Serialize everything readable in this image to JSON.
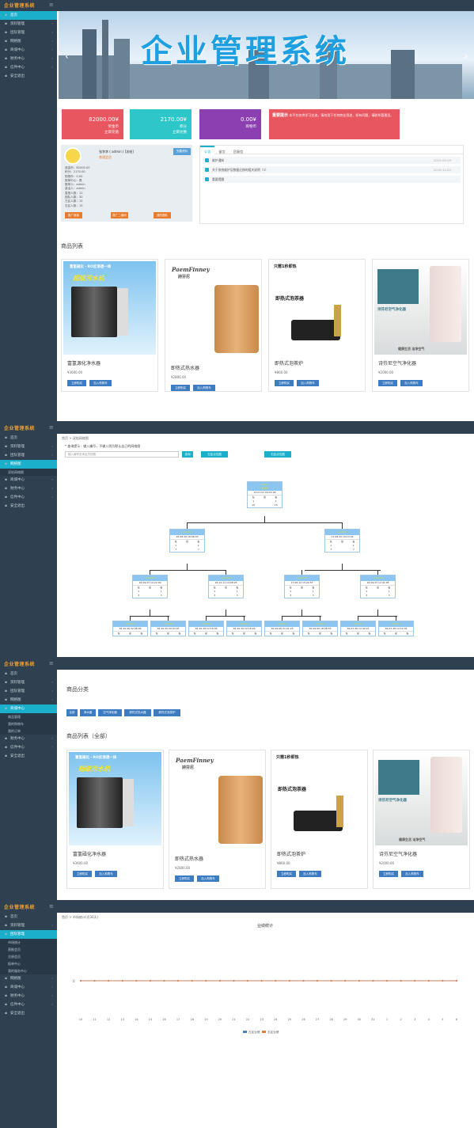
{
  "app": {
    "brand": "企业管理系统",
    "toggle_icon": "menu-icon"
  },
  "panel1": {
    "sidebar": [
      {
        "label": "首页",
        "active": true
      },
      {
        "label": "资料管理",
        "chevron": true
      },
      {
        "label": "团队管理",
        "chevron": true
      },
      {
        "label": "网络图",
        "chevron": true
      },
      {
        "label": "商城中心",
        "chevron": true
      },
      {
        "label": "财务中心",
        "chevron": true
      },
      {
        "label": "信件中心",
        "chevron": true
      },
      {
        "label": "安全退出",
        "chevron": false
      }
    ],
    "banner_title": "企业管理系统",
    "stats": [
      {
        "value": "82000.00¥",
        "label1": "奖金币",
        "label2": "立即充值",
        "color": "#e8575f"
      },
      {
        "value": "2170.00¥",
        "label1": "积分",
        "label2": "立即兑换",
        "color": "#2ec7c9"
      },
      {
        "value": "0.00¥",
        "label1": "购物币",
        "label2": "",
        "color": "#8b3fb0"
      }
    ],
    "notice": {
      "title": "重要提示",
      "text": "本平台仅供学习交流，请勿用于任何商业用途，如有问题，请联系管理员。"
    },
    "profile": {
      "name": "张李李 ( admin ) [冻结]",
      "level": "普通会员",
      "edit": "完善资料",
      "rows": [
        "奖金币：82000.00",
        "积分：2170.00",
        "购物币：0.00",
        "报单中心：是",
        "推荐人：admin",
        "激活人：admin",
        "直推人数：12",
        "团队人数：30",
        "左区人数：15",
        "右区人数：15"
      ],
      "buttons": [
        "推广链接",
        "推广二维码",
        "我的团队"
      ]
    },
    "tabs": [
      "公告",
      "留言",
      "回复信"
    ],
    "announcements": [
      {
        "text": "维护通知",
        "date": "2019-09-09"
      },
      {
        "text": "关于系统维护及数据迁移的相关说明（3）",
        "date": "2019-12-03"
      },
      {
        "text": "重要提醒",
        "date": ""
      }
    ],
    "products_title": "商品列表",
    "products": [
      {
        "name": "富氢源化净水器",
        "price": "¥3600.00",
        "buy": "立即购买",
        "cart": "加入购物车"
      },
      {
        "name": "即热式热水器",
        "price": "¥2800.00",
        "buy": "立即购买",
        "cart": "加入购物车"
      },
      {
        "name": "即热式泡茶炉",
        "price": "¥860.00",
        "buy": "立即购买",
        "cart": "加入购物车"
      },
      {
        "name": "诗芬尼空气净化器",
        "price": "¥2000.00",
        "buy": "立即购买",
        "cart": "加入购物车"
      }
    ],
    "img_texts": {
      "p1a": "富氢磁化・RO反渗透一体",
      "p1b": "超级污水机",
      "p2a": "PaemFinney",
      "p2b": "詩芬尼",
      "p3a": "只需1秒即热",
      "p3b": "即热式泡茶器",
      "p4a": "诗芬尼空气净化器",
      "p4b": "健康生活 洁净空气"
    }
  },
  "panel2": {
    "sidebar": [
      {
        "label": "首页"
      },
      {
        "label": "资料管理",
        "chevron": true
      },
      {
        "label": "团队管理",
        "chevron": true
      },
      {
        "label": "网络图",
        "chevron": true,
        "active": true
      },
      {
        "label": "双轨网络图",
        "sub": true
      },
      {
        "label": "商城中心",
        "chevron": true
      },
      {
        "label": "财务中心",
        "chevron": true
      },
      {
        "label": "信件中心",
        "chevron": true
      },
      {
        "label": "安全退出"
      }
    ],
    "breadcrumb": "首页  >  双轨网络图",
    "hint": "* 查询提示：输入编号，不输入则为默认自己的网络图",
    "search_placeholder": "输入编号查询会员的图",
    "search_btn": "查询",
    "btn_left": "左区点位图",
    "btn_right": "右区点位图",
    "tree": {
      "root": {
        "id": "admin",
        "name": "张李李",
        "time": "12-07-01 09:53:28",
        "l": "1",
        "r": "1",
        "lt": "15",
        "rt": "15"
      },
      "l1": [
        {
          "id": "user001",
          "time": "16-08-20 16:58:33",
          "l": "1",
          "r": "1",
          "lt": "7",
          "rt": "7"
        },
        {
          "id": "user002",
          "time": "17-08-22 15:13:42",
          "l": "1",
          "r": "1",
          "lt": "7",
          "rt": "7"
        }
      ],
      "l2": [
        {
          "id": "user003",
          "time": "16-09-03 10:22:40",
          "l": "1",
          "r": "1",
          "lt": "3",
          "rt": "3"
        },
        {
          "id": "user004",
          "time": "18-12-11 14:08:25",
          "l": "1",
          "r": "1",
          "lt": "3",
          "rt": "3"
        },
        {
          "id": "user005",
          "time": "17-08-12 15:20:57",
          "l": "1",
          "r": "1",
          "lt": "3",
          "rt": "3"
        },
        {
          "id": "user006",
          "time": "16-09-03 12:41:05",
          "l": "1",
          "r": "1",
          "lt": "3",
          "rt": "3"
        }
      ],
      "l3": [
        {
          "id": "user007",
          "time": "16-10-26 02:08:09"
        },
        {
          "id": "user008",
          "time": "16-10-20 02:03:07"
        },
        {
          "id": "user009",
          "time": "16-10-18 12:18:30"
        },
        {
          "id": "user010",
          "time": "16-10-19 12:18:29"
        },
        {
          "id": "user011",
          "time": "16-09-06 21:01:23"
        },
        {
          "id": "user012",
          "time": "16-09-06 18:08:53"
        },
        {
          "id": "user013",
          "time": "16-07-26 12:49:21"
        },
        {
          "id": "user014",
          "time": "16-07-28 12:12:42"
        }
      ]
    }
  },
  "panel3": {
    "sidebar": [
      {
        "label": "首页"
      },
      {
        "label": "资料管理",
        "chevron": true
      },
      {
        "label": "团队管理",
        "chevron": true
      },
      {
        "label": "网络图",
        "chevron": true
      },
      {
        "label": "商城中心",
        "chevron": true,
        "active": true
      },
      {
        "label": "商品管理",
        "sub": true
      },
      {
        "label": "我的购物车",
        "sub": true
      },
      {
        "label": "我的订单",
        "sub": true
      },
      {
        "label": "财务中心",
        "chevron": true
      },
      {
        "label": "信件中心",
        "chevron": true
      },
      {
        "label": "安全退出"
      }
    ],
    "cat_title": "商品分类",
    "categories": [
      "全部",
      "净水器",
      "空气净化器",
      "即热式热水器",
      "即热式泡茶炉"
    ],
    "list_title": "商品列表（全部）",
    "products": [
      {
        "name": "富氢磁化净水器",
        "price": "¥3600.00",
        "buy": "立即购买",
        "cart": "加入购物车"
      },
      {
        "name": "即热式热水器",
        "price": "¥2800.00",
        "buy": "立即购买",
        "cart": "加入购物车"
      },
      {
        "name": "即热式泡茶炉",
        "price": "¥860.00",
        "buy": "立即购买",
        "cart": "加入购物车"
      },
      {
        "name": "诗芬尼空气净化器",
        "price": "¥2000.00",
        "buy": "立即购买",
        "cart": "加入购物车"
      }
    ]
  },
  "panel4": {
    "sidebar": [
      {
        "label": "首页"
      },
      {
        "label": "资料管理",
        "chevron": true
      },
      {
        "label": "团队管理",
        "chevron": true,
        "active": true
      },
      {
        "label": "市场统计",
        "sub": true
      },
      {
        "label": "直推会员",
        "sub": true
      },
      {
        "label": "注册会员",
        "sub": true
      },
      {
        "label": "报单中心",
        "sub": true
      },
      {
        "label": "我的服务中心",
        "sub": true
      },
      {
        "label": "网络图",
        "chevron": true
      },
      {
        "label": "商城中心",
        "chevron": true
      },
      {
        "label": "财务中心",
        "chevron": true
      },
      {
        "label": "信件中心",
        "chevron": true
      },
      {
        "label": "安全退出"
      }
    ],
    "breadcrumb": "首页  >  市场统计(近30天)",
    "chart_data": {
      "type": "line",
      "title": "业绩统计",
      "x": [
        "10",
        "11",
        "12",
        "13",
        "14",
        "15",
        "16",
        "17",
        "18",
        "19",
        "20",
        "21",
        "22",
        "23",
        "24",
        "25",
        "26",
        "27",
        "28",
        "29",
        "30",
        "31",
        "1",
        "2",
        "3",
        "4",
        "5",
        "6"
      ],
      "series": [
        {
          "name": "左区业绩",
          "color": "#4a7fc0",
          "values": [
            0,
            0,
            0,
            0,
            0,
            0,
            0,
            0,
            0,
            0,
            0,
            0,
            0,
            0,
            0,
            0,
            0,
            0,
            0,
            0,
            0,
            0,
            0,
            0,
            0,
            0,
            0,
            0
          ]
        },
        {
          "name": "右区业绩",
          "color": "#e07b3a",
          "values": [
            0,
            0,
            0,
            0,
            0,
            0,
            0,
            0,
            0,
            0,
            0,
            0,
            0,
            0,
            0,
            0,
            0,
            0,
            0,
            0,
            0,
            0,
            0,
            0,
            0,
            0,
            0,
            0
          ]
        }
      ],
      "yticks": [
        "0"
      ],
      "legend": "bottom-center"
    }
  }
}
